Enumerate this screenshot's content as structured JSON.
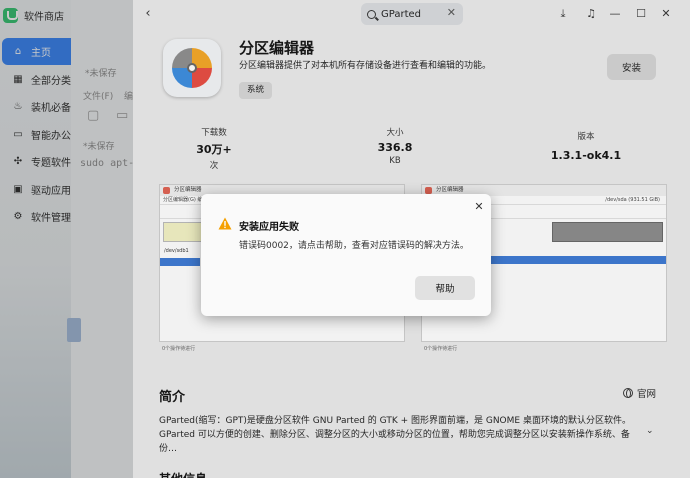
{
  "app": {
    "name": "软件商店"
  },
  "sidebar": {
    "items": [
      {
        "label": "主页",
        "icon": "home-icon",
        "glyph": "⌂"
      },
      {
        "label": "全部分类",
        "icon": "grid-icon",
        "glyph": "▦"
      },
      {
        "label": "装机必备",
        "icon": "flame-icon",
        "glyph": "♨"
      },
      {
        "label": "智能办公",
        "icon": "monitor-icon",
        "glyph": "▭"
      },
      {
        "label": "专题软件",
        "icon": "network-icon",
        "glyph": "✣"
      },
      {
        "label": "驱动应用",
        "icon": "image-icon",
        "glyph": "▣"
      },
      {
        "label": "软件管理",
        "icon": "gear-icon",
        "glyph": "⚙"
      }
    ]
  },
  "background_window": {
    "unsaved_1": "*未保存",
    "file_menu": "文件(F)",
    "edit_menu": "编",
    "unsaved_2": "*未保存",
    "command": "sudo apt-g"
  },
  "search": {
    "value": "GParted"
  },
  "app_detail": {
    "title": "分区编辑器",
    "description": "分区编辑器提供了对本机所有存储设备进行查看和编辑的功能。",
    "tag": "系统",
    "install_label": "安装",
    "stats": {
      "downloads": {
        "label": "下载数",
        "value": "30万+",
        "unit": "次"
      },
      "size": {
        "label": "大小",
        "value": "336.8",
        "unit": "KB"
      },
      "version": {
        "label": "版本",
        "value": "1.3.1-ok4.1"
      }
    }
  },
  "screenshots": [
    {
      "title": "分区编辑器",
      "menu": "分区编辑器(G) 编辑",
      "row": "/dev/sdb1",
      "caption": "0个操作待进行"
    },
    {
      "title": "分区编辑器",
      "menu": "",
      "row": "/dev/sda (931.51 GiB)",
      "caption": "0个操作待进行"
    }
  ],
  "intro": {
    "title": "简介",
    "website": "官网",
    "text": "GParted(缩写：GPT)是硬盘分区软件 GNU Parted 的 GTK + 图形界面前端，是 GNOME 桌面环境的默认分区软件。 GParted 可以方便的创建、删除分区、调整分区的大小或移动分区的位置，帮助您完成调整分区以安装新操作系统、备份…"
  },
  "more_info": {
    "title": "其他信息"
  },
  "dialog": {
    "title": "安装应用失败",
    "message": "错误码0002，请点击帮助，查看对应错误码的解决方法。",
    "help_label": "帮助"
  }
}
